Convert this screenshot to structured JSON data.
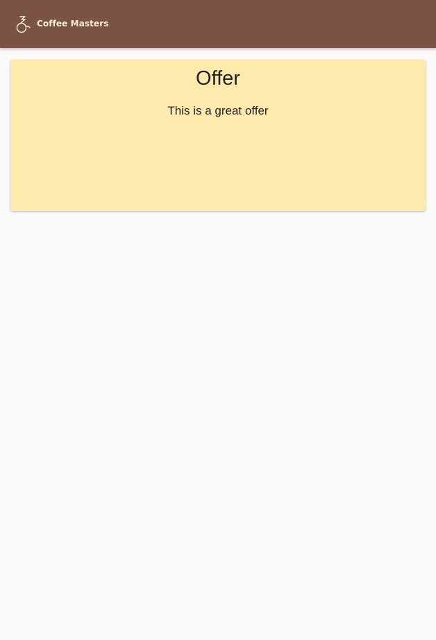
{
  "header": {
    "brand_name": "Coffee Masters",
    "logo_icon": "coffee-cup-icon",
    "background_color": "#7b5344",
    "text_color": "#fbf0d8"
  },
  "offer": {
    "title": "Offer",
    "description": "This is a great offer",
    "background_color": "#ffeaae"
  },
  "page": {
    "background_color": "#fafafa"
  }
}
